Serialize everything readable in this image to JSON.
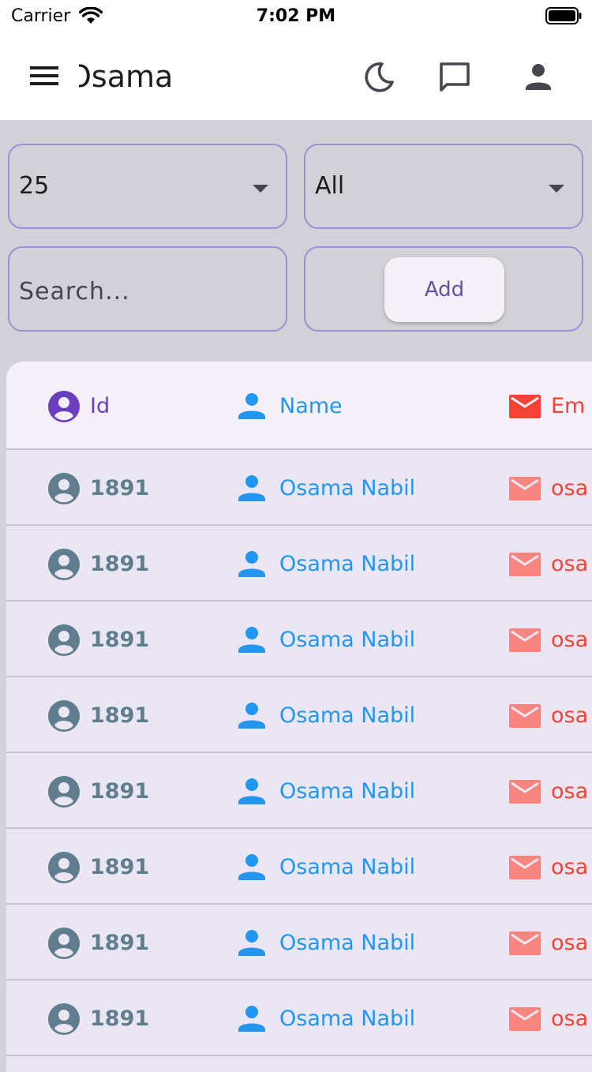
{
  "status_bar": {
    "carrier": "Carrier",
    "time": "7:02 PM"
  },
  "app_bar": {
    "title": "Osama"
  },
  "filters": {
    "page_size": "25",
    "category": "All"
  },
  "search": {
    "placeholder": "Search..."
  },
  "actions": {
    "add_label": "Add"
  },
  "table": {
    "headers": {
      "id": "Id",
      "name": "Name",
      "email": "Em"
    },
    "rows": [
      {
        "id": "1891",
        "name": "Osama Nabil",
        "email": "osa"
      },
      {
        "id": "1891",
        "name": "Osama Nabil",
        "email": "osa"
      },
      {
        "id": "1891",
        "name": "Osama Nabil",
        "email": "osa"
      },
      {
        "id": "1891",
        "name": "Osama Nabil",
        "email": "osa"
      },
      {
        "id": "1891",
        "name": "Osama Nabil",
        "email": "osa"
      },
      {
        "id": "1891",
        "name": "Osama Nabil",
        "email": "osa"
      },
      {
        "id": "1891",
        "name": "Osama Nabil",
        "email": "osa"
      },
      {
        "id": "1891",
        "name": "Osama Nabil",
        "email": "osa"
      }
    ]
  },
  "colors": {
    "accent_purple": "#6a3fbf",
    "name_blue": "#2196f3",
    "email_red": "#f44336",
    "email_red_light": "#f88580",
    "id_gray": "#5f7d8c"
  },
  "icons": {
    "menu": "menu-icon",
    "moon": "moon-icon",
    "chat": "chat-icon",
    "account": "person-icon",
    "id_header": "account-circle-icon",
    "name": "person-icon",
    "email": "mail-icon"
  }
}
